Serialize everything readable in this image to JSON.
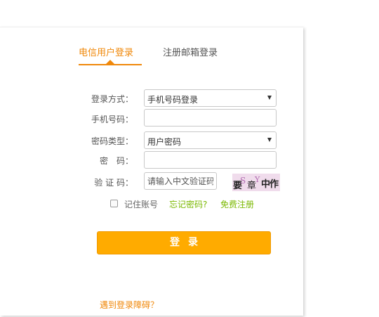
{
  "tabs": {
    "active": "电信用户登录",
    "inactive": "注册邮箱登录"
  },
  "form": {
    "login_method": {
      "label": "登录方式：",
      "value": "手机号码登录"
    },
    "phone": {
      "label": "手机号码：",
      "value": "",
      "placeholder": ""
    },
    "password_type": {
      "label": "密码类型：",
      "value": "用户密码"
    },
    "password": {
      "label": "密　码：",
      "value": ""
    },
    "captcha": {
      "label": "验 证 码：",
      "placeholder": "请输入中文验证码",
      "image_text": [
        "要",
        "S",
        "章",
        "Y",
        "中",
        "作"
      ]
    }
  },
  "options": {
    "remember_label": "记住账号",
    "remember_checked": false,
    "forgot_password": "忘记密码?",
    "free_register": "免费注册"
  },
  "login_button": "登录",
  "trouble_link": "遇到登录障碍？",
  "colors": {
    "accent_orange": "#f0880a",
    "button_orange": "#ffab00",
    "link_green": "#7ab800",
    "captcha_bg": "#f0dcec"
  }
}
